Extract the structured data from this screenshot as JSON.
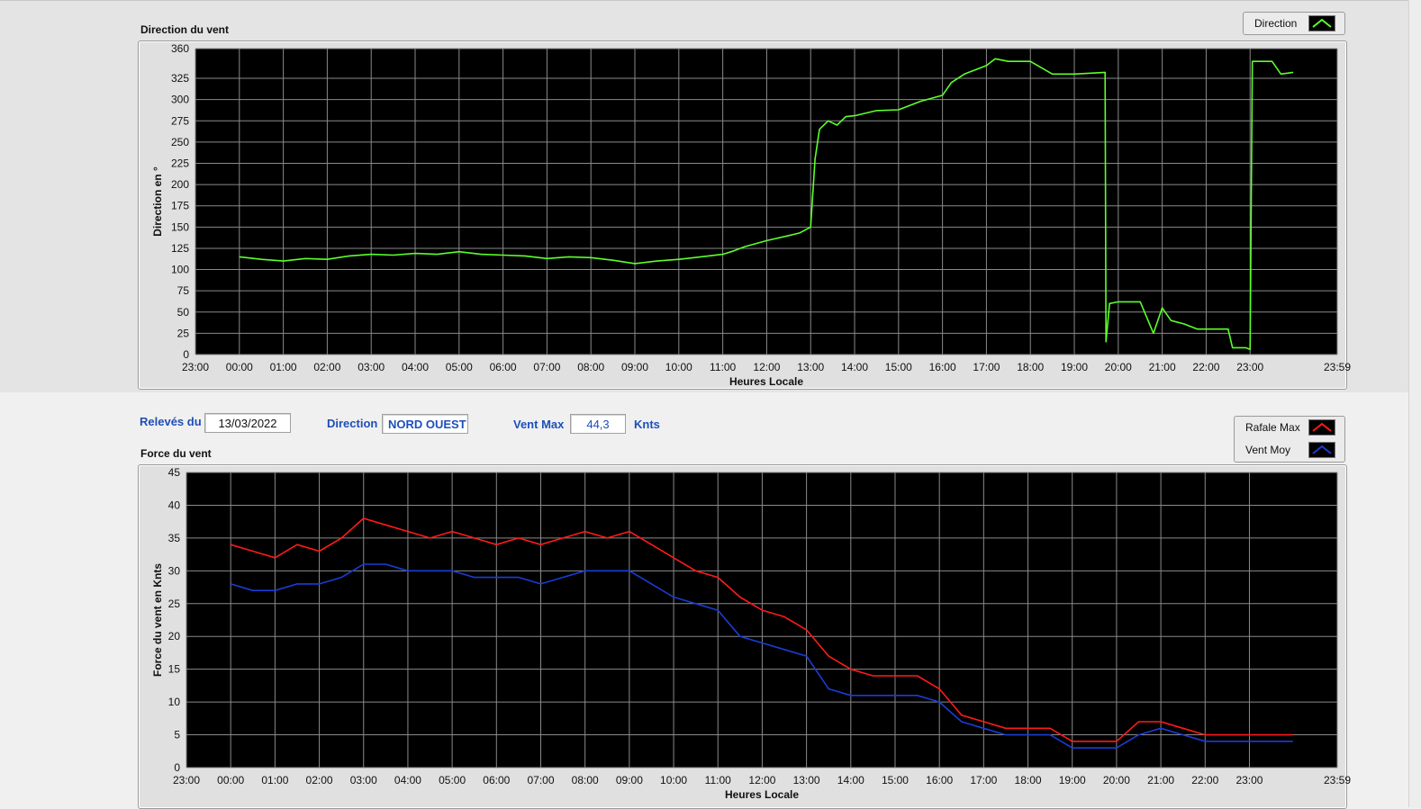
{
  "direction_panel": {
    "title": "Direction du vent",
    "legend": {
      "label": "Direction",
      "color": "#5cff2a"
    }
  },
  "info_bar": {
    "releves_label": "Relevés du",
    "date_value": "13/03/2022",
    "direction_label": "Direction",
    "direction_value": "NORD OUEST",
    "ventmax_label": "Vent Max",
    "ventmax_value": "44,3",
    "unit_label": "Knts"
  },
  "force_panel": {
    "title": "Force du vent",
    "legend": [
      {
        "label": "Rafale Max",
        "color": "#ff1a1a"
      },
      {
        "label": "Vent Moy",
        "color": "#1a3dd6"
      }
    ]
  },
  "chart_data": [
    {
      "type": "line",
      "title": "",
      "xlabel": "Heures Locale",
      "ylabel": "Direction en °",
      "x_tick_labels": [
        "23:00",
        "00:00",
        "01:00",
        "02:00",
        "03:00",
        "04:00",
        "05:00",
        "06:00",
        "07:00",
        "08:00",
        "09:00",
        "10:00",
        "11:00",
        "12:00",
        "13:00",
        "14:00",
        "15:00",
        "16:00",
        "17:00",
        "18:00",
        "19:00",
        "20:00",
        "21:00",
        "22:00",
        "23:00",
        "23:59"
      ],
      "y_tick_labels": [
        "0",
        "25",
        "50",
        "75",
        "100",
        "125",
        "150",
        "175",
        "200",
        "225",
        "250",
        "275",
        "300",
        "325",
        "360"
      ],
      "xlim": [
        -1,
        24.983
      ],
      "ylim": [
        0,
        360
      ],
      "grid": true,
      "legend_position": "top-right",
      "series": [
        {
          "name": "Direction",
          "color": "#5cff2a",
          "x": [
            0,
            0.5,
            1,
            1.5,
            2,
            2.5,
            3,
            3.5,
            4,
            4.5,
            5,
            5.5,
            6,
            6.5,
            7,
            7.5,
            8,
            8.5,
            9,
            9.5,
            10,
            10.5,
            11,
            11.25,
            11.5,
            12,
            12.5,
            12.75,
            13,
            13.1,
            13.2,
            13.4,
            13.6,
            13.8,
            14,
            14.5,
            15,
            15.5,
            16,
            16.2,
            16.5,
            17,
            17.2,
            17.5,
            18,
            18.5,
            19,
            19.7,
            19.72,
            19.8,
            20,
            20.5,
            20.8,
            21,
            21.2,
            21.5,
            21.8,
            22,
            22.5,
            22.6,
            22.9,
            23,
            23.05,
            23.2,
            23.5,
            23.7,
            23.98
          ],
          "y": [
            115,
            112,
            110,
            113,
            112,
            116,
            118,
            117,
            119,
            118,
            121,
            118,
            117,
            116,
            113,
            115,
            114,
            111,
            107,
            110,
            112,
            115,
            118,
            122,
            127,
            134,
            140,
            143,
            150,
            230,
            265,
            275,
            270,
            280,
            281,
            287,
            288,
            298,
            305,
            320,
            330,
            340,
            348,
            345,
            345,
            330,
            330,
            332,
            15,
            60,
            62,
            62,
            25,
            55,
            40,
            36,
            30,
            30,
            30,
            8,
            8,
            6,
            345,
            345,
            345,
            330,
            332
          ]
        }
      ]
    },
    {
      "type": "line",
      "title": "",
      "xlabel": "Heures Locale",
      "ylabel": "Force du vent en Knts",
      "x_tick_labels": [
        "23:00",
        "00:00",
        "01:00",
        "02:00",
        "03:00",
        "04:00",
        "05:00",
        "06:00",
        "07:00",
        "08:00",
        "09:00",
        "10:00",
        "11:00",
        "12:00",
        "13:00",
        "14:00",
        "15:00",
        "16:00",
        "17:00",
        "18:00",
        "19:00",
        "20:00",
        "21:00",
        "22:00",
        "23:00",
        "23:59"
      ],
      "y_tick_labels": [
        "0",
        "5",
        "10",
        "15",
        "20",
        "25",
        "30",
        "35",
        "40",
        "45"
      ],
      "xlim": [
        -1,
        24.983
      ],
      "ylim": [
        0,
        45
      ],
      "grid": true,
      "legend_position": "top-right",
      "series": [
        {
          "name": "Rafale Max",
          "color": "#ff1a1a",
          "x": [
            0,
            0.5,
            1,
            1.5,
            2,
            2.5,
            3,
            3.5,
            4,
            4.5,
            5,
            5.5,
            6,
            6.5,
            7,
            7.5,
            8,
            8.5,
            9,
            9.5,
            10,
            10.5,
            11,
            11.5,
            12,
            12.5,
            13,
            13.5,
            14,
            14.5,
            15,
            15.5,
            16,
            16.5,
            17,
            17.5,
            18,
            18.5,
            19,
            19.5,
            20,
            20.5,
            21,
            21.5,
            22,
            22.5,
            23,
            23.5,
            23.98
          ],
          "y": [
            34,
            33,
            32,
            34,
            33,
            35,
            38,
            37,
            36,
            35,
            36,
            35,
            34,
            35,
            34,
            35,
            36,
            35,
            36,
            34,
            32,
            30,
            29,
            26,
            24,
            23,
            21,
            17,
            15,
            14,
            14,
            14,
            12,
            8,
            7,
            6,
            6,
            6,
            4,
            4,
            4,
            7,
            7,
            6,
            5,
            5,
            5,
            5,
            5
          ]
        },
        {
          "name": "Vent Moy",
          "color": "#1a3dd6",
          "x": [
            0,
            0.5,
            1,
            1.5,
            2,
            2.5,
            3,
            3.5,
            4,
            4.5,
            5,
            5.5,
            6,
            6.5,
            7,
            7.5,
            8,
            8.5,
            9,
            9.5,
            10,
            10.5,
            11,
            11.5,
            12,
            12.5,
            13,
            13.5,
            14,
            14.5,
            15,
            15.5,
            16,
            16.5,
            17,
            17.5,
            18,
            18.5,
            19,
            19.5,
            20,
            20.5,
            21,
            21.5,
            22,
            22.5,
            23,
            23.5,
            23.98
          ],
          "y": [
            28,
            27,
            27,
            28,
            28,
            29,
            31,
            31,
            30,
            30,
            30,
            29,
            29,
            29,
            28,
            29,
            30,
            30,
            30,
            28,
            26,
            25,
            24,
            20,
            19,
            18,
            17,
            12,
            11,
            11,
            11,
            11,
            10,
            7,
            6,
            5,
            5,
            5,
            3,
            3,
            3,
            5,
            6,
            5,
            4,
            4,
            4,
            4,
            4
          ]
        }
      ]
    }
  ]
}
